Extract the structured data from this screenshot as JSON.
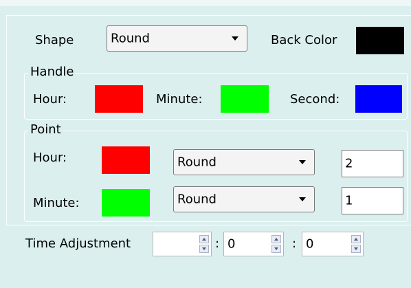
{
  "header": {
    "shape_label": "Shape",
    "shape_value": "Round",
    "back_color_label": "Back Color",
    "back_color": "#000000"
  },
  "handle": {
    "title": "Handle",
    "hour_label": "Hour:",
    "hour_color": "#ff0000",
    "minute_label": "Minute:",
    "minute_color": "#00ff00",
    "second_label": "Second:",
    "second_color": "#0000ff"
  },
  "point": {
    "title": "Point",
    "hour_label": "Hour:",
    "hour_color": "#ff0000",
    "hour_shape": "Round",
    "hour_size": "2",
    "minute_label": "Minute:",
    "minute_color": "#00ff00",
    "minute_shape": "Round",
    "minute_size": "1"
  },
  "time_adjustment": {
    "label": "Time Adjustment",
    "hours": "",
    "separator1": ":",
    "minutes": "0",
    "separator2": ":",
    "seconds": "0"
  }
}
